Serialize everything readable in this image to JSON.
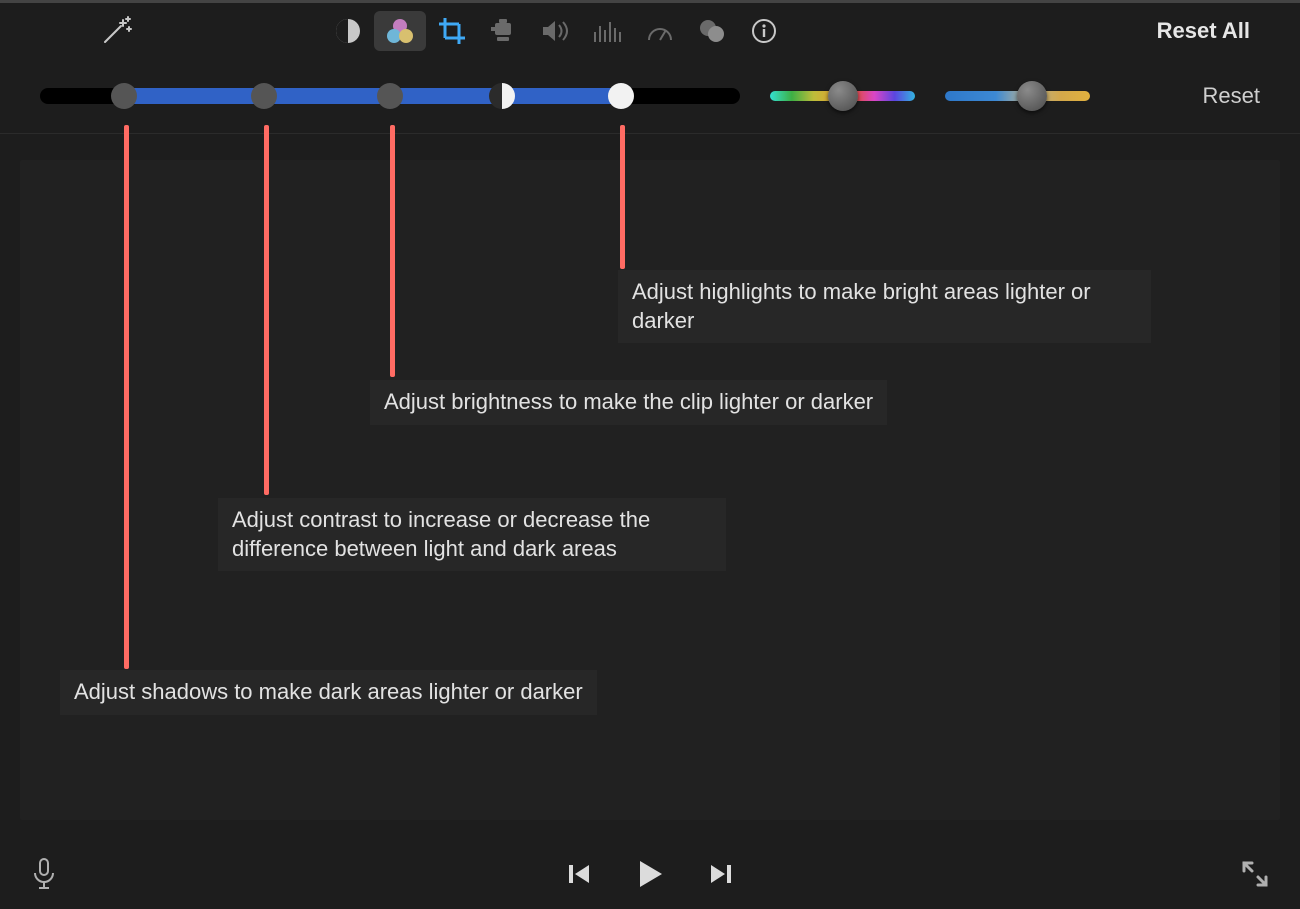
{
  "toolbar": {
    "icons": [
      "enhance",
      "color-balance",
      "color-correction",
      "crop",
      "stabilization",
      "volume",
      "noise-reduction",
      "speed",
      "color-filter",
      "info"
    ],
    "selectedIndex": 2,
    "resetAllLabel": "Reset All"
  },
  "sliders": {
    "multi": {
      "activeStartPct": 12,
      "activeEndPct": 83,
      "handles": {
        "shadows": {
          "pct": 12
        },
        "contrast": {
          "pct": 32
        },
        "brightness": {
          "pct": 50
        },
        "midtones": {
          "pct": 66
        },
        "highlights": {
          "pct": 83
        }
      }
    },
    "saturation": {
      "valuePct": 50
    },
    "temperature": {
      "valuePct": 60
    },
    "resetLabel": "Reset"
  },
  "callouts": {
    "shadows": "Adjust shadows to make dark areas lighter or darker",
    "contrast": "Adjust contrast to increase or decrease the difference between light and dark areas",
    "brightness": "Adjust brightness to make the clip lighter or darker",
    "highlights": "Adjust highlights to make bright areas lighter or darker"
  },
  "footer": {
    "mic": "mic-icon",
    "prev": "previous-icon",
    "play": "play-icon",
    "next": "next-icon",
    "fullscreen": "fullscreen-icon"
  }
}
